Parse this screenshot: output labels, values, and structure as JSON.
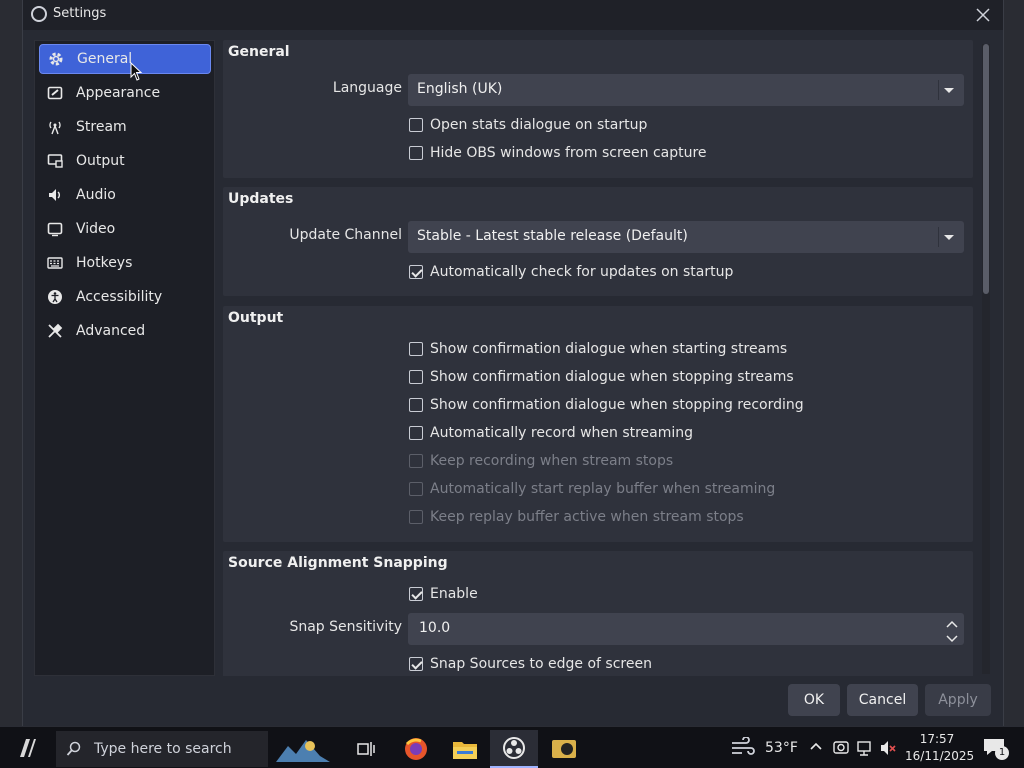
{
  "window": {
    "title": "Settings"
  },
  "sidebar": {
    "items": [
      {
        "label": "General",
        "icon": "gear-icon",
        "active": true
      },
      {
        "label": "Appearance",
        "icon": "palette-icon",
        "active": false
      },
      {
        "label": "Stream",
        "icon": "antenna-icon",
        "active": false
      },
      {
        "label": "Output",
        "icon": "monitor-output-icon",
        "active": false
      },
      {
        "label": "Audio",
        "icon": "speaker-icon",
        "active": false
      },
      {
        "label": "Video",
        "icon": "screen-icon",
        "active": false
      },
      {
        "label": "Hotkeys",
        "icon": "keyboard-icon",
        "active": false
      },
      {
        "label": "Accessibility",
        "icon": "accessibility-icon",
        "active": false
      },
      {
        "label": "Advanced",
        "icon": "tools-icon",
        "active": false
      }
    ]
  },
  "general": {
    "title": "General",
    "language_label": "Language",
    "language_value": "English (UK)",
    "checks": [
      {
        "label": "Open stats dialogue on startup",
        "checked": false,
        "disabled": false
      },
      {
        "label": "Hide OBS windows from screen capture",
        "checked": false,
        "disabled": false
      }
    ]
  },
  "updates": {
    "title": "Updates",
    "channel_label": "Update Channel",
    "channel_value": "Stable - Latest stable release (Default)",
    "checks": [
      {
        "label": "Automatically check for updates on startup",
        "checked": true,
        "disabled": false
      }
    ]
  },
  "output": {
    "title": "Output",
    "checks": [
      {
        "label": "Show confirmation dialogue when starting streams",
        "checked": false,
        "disabled": false
      },
      {
        "label": "Show confirmation dialogue when stopping streams",
        "checked": false,
        "disabled": false
      },
      {
        "label": "Show confirmation dialogue when stopping recording",
        "checked": false,
        "disabled": false
      },
      {
        "label": "Automatically record when streaming",
        "checked": false,
        "disabled": false
      },
      {
        "label": "Keep recording when stream stops",
        "checked": false,
        "disabled": true
      },
      {
        "label": "Automatically start replay buffer when streaming",
        "checked": false,
        "disabled": true
      },
      {
        "label": "Keep replay buffer active when stream stops",
        "checked": false,
        "disabled": true
      }
    ]
  },
  "snapping": {
    "title": "Source Alignment Snapping",
    "enable_label": "Enable",
    "enable_checked": true,
    "sensitivity_label": "Snap Sensitivity",
    "sensitivity_value": "10.0",
    "edge_label": "Snap Sources to edge of screen",
    "edge_checked": true
  },
  "buttons": {
    "ok": "OK",
    "cancel": "Cancel",
    "apply": "Apply"
  },
  "taskbar": {
    "search_placeholder": "Type here to search",
    "weather": "53°F",
    "time": "17:57",
    "date": "16/11/2025",
    "notification_count": "1"
  },
  "colors": {
    "accent": "#3f63d8",
    "window_bg": "#272a33",
    "group_bg": "#2f323c"
  }
}
